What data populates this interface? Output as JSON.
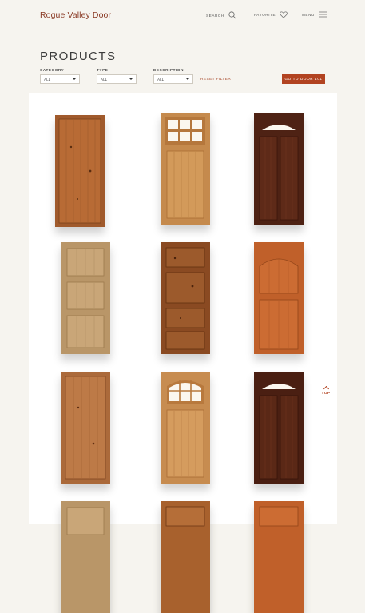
{
  "header": {
    "logo": "Rogue Valley Door",
    "search_label": "SEARCH",
    "favorite_label": "FAVORITE",
    "menu_label": "MENU"
  },
  "page": {
    "title": "PRODUCTS"
  },
  "filters": {
    "category": {
      "label": "CATEGORY",
      "value": "ALL"
    },
    "type": {
      "label": "TYPE",
      "value": "ALL"
    },
    "description": {
      "label": "DESCRIPTION",
      "value": "ALL"
    },
    "reset_label": "RESET FILTER"
  },
  "cta": {
    "label": "GO TO DOOR 101"
  },
  "top_button": {
    "label": "TOP"
  },
  "colors": {
    "brand": "#8a3a25",
    "accent": "#b24321",
    "background": "#f6f4ef"
  }
}
